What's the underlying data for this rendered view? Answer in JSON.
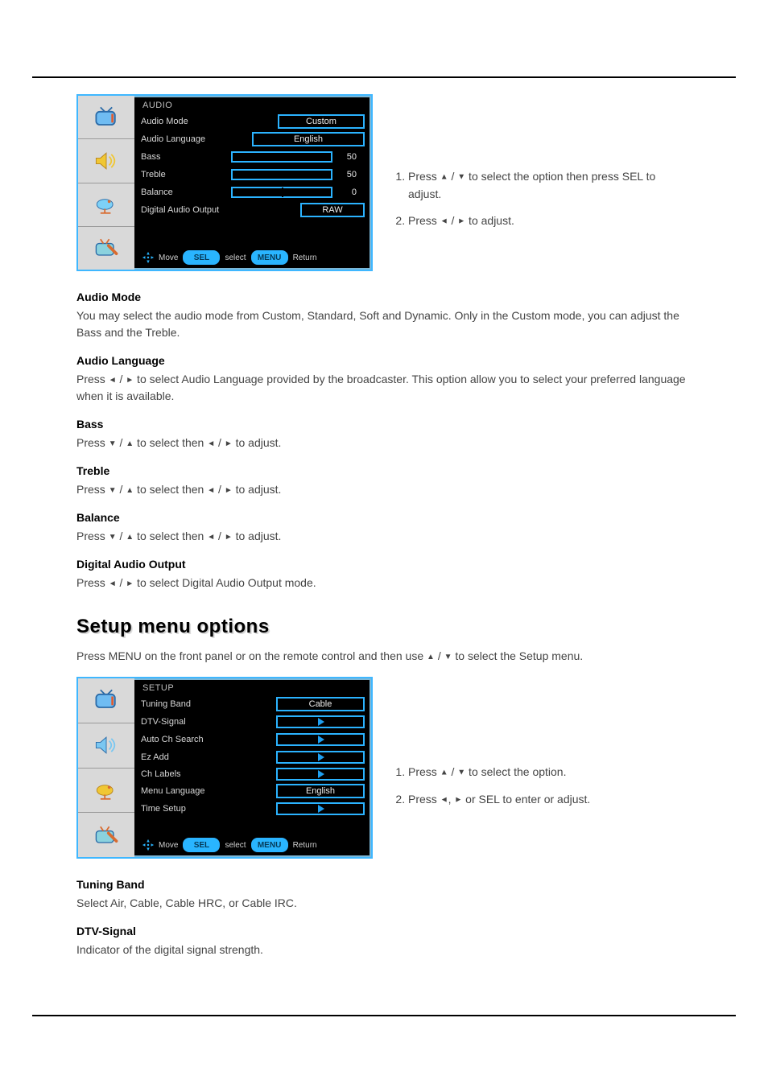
{
  "audio_osd": {
    "header": "AUDIO",
    "rows": {
      "mode_label": "Audio Mode",
      "mode_value": "Custom",
      "lang_label": "Audio Language",
      "lang_value": "English",
      "bass_label": "Bass",
      "bass_value": "50",
      "treble_label": "Treble",
      "treble_value": "50",
      "balance_label": "Balance",
      "balance_value": "0",
      "dao_label": "Digital Audio Output",
      "dao_value": "RAW"
    },
    "footer": {
      "move": "Move",
      "sel": "SEL",
      "select": "select",
      "menu": "MENU",
      "return": "Return"
    }
  },
  "audio_instructions": {
    "step1a": "Press ",
    "step1b": " to select the option then press ",
    "step1c": " to adjust.",
    "step2a": "Press ",
    "step2b": " to adjust."
  },
  "audio_defs": {
    "mode_label": "Audio Mode",
    "mode_text": "You may select the audio mode from Custom, Standard, Soft and Dynamic. Only in the Custom mode, you can adjust the Bass and the Treble.",
    "lang_label": "Audio Language",
    "lang_text_a": "Press ",
    "lang_text_b": " to select Audio Language provided by the broadcaster. This option allow you to select your preferred language when it is available.",
    "bass_label": "Bass",
    "bass_text_a": "Press ",
    "bass_text_b": " to select then ",
    "bass_text_c": " to adjust.",
    "treble_label": "Treble",
    "treble_text_a": "Press ",
    "treble_text_b": " to select then ",
    "treble_text_c": " to adjust.",
    "balance_label": "Balance",
    "balance_text_a": "Press ",
    "balance_text_b": " to select then ",
    "balance_text_c": " to adjust.",
    "dao_label": "Digital Audio Output",
    "dao_text_a": "Press ",
    "dao_text_b": " to select Digital Audio Output mode."
  },
  "section_title": "Setup menu options",
  "setup_intro_a": "Press MENU on the front panel or on the remote control and then use ",
  "setup_intro_b": " to select the Setup menu.",
  "setup_osd": {
    "header": "SETUP",
    "rows": {
      "tb_label": "Tuning Band",
      "tb_value": "Cable",
      "dtv_label": "DTV-Signal",
      "dtv_value": "",
      "auto_label": "Auto Ch Search",
      "auto_value": "",
      "ezadd_label": "Ez Add",
      "ezadd_value": "",
      "lang_label": "Menu Language",
      "lang_value": "English",
      "time_label": "Time Setup",
      "time_value": ""
    },
    "footer": {
      "move": "Move",
      "sel": "SEL",
      "select": "select",
      "menu": "MENU",
      "return": "Return"
    }
  },
  "setup_instructions": {
    "step1a": "Press ",
    "step1b": " to select the option.",
    "step2a": "Press ",
    "step2b": ", ",
    "step2c": " or SEL to enter or adjust."
  },
  "setup_defs": {
    "tb_label": "Tuning Band",
    "tb_text": "Select Air, Cable, Cable HRC, or Cable IRC.",
    "dtv_label": "DTV-Signal",
    "dtv_text": "Indicator of the digital signal strength."
  }
}
